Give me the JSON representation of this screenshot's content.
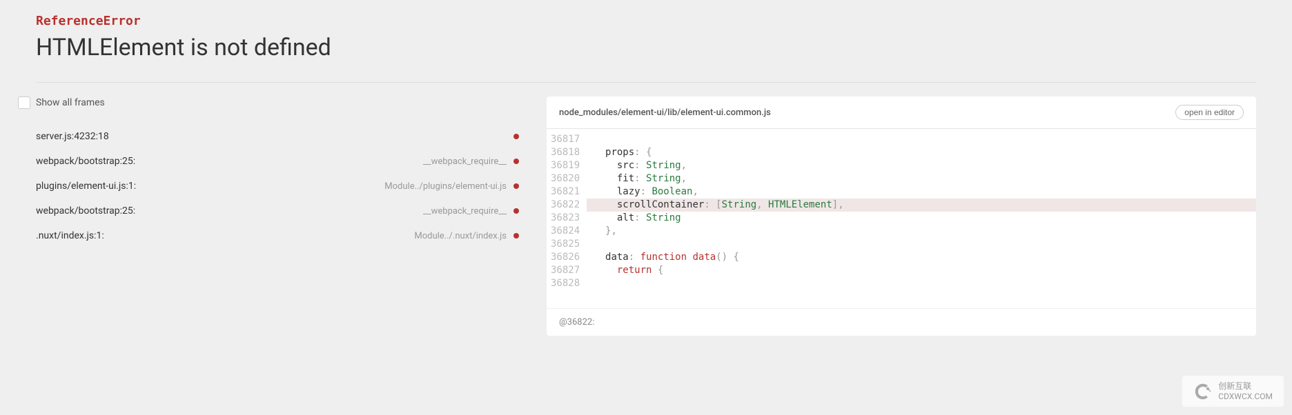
{
  "error": {
    "type": "ReferenceError",
    "message": "HTMLElement is not defined"
  },
  "showAllFrames": {
    "label": "Show all frames",
    "checked": false
  },
  "frames": [
    {
      "left": "server.js:4232:18",
      "right": ""
    },
    {
      "left": "webpack/bootstrap:25:",
      "right": "__webpack_require__"
    },
    {
      "left": "plugins/element-ui.js:1:",
      "right": "Module../plugins/element-ui.js"
    },
    {
      "left": "webpack/bootstrap:25:",
      "right": "__webpack_require__"
    },
    {
      "left": ".nuxt/index.js:1:",
      "right": "Module../.nuxt/index.js"
    }
  ],
  "source": {
    "filePath": "node_modules/element-ui/lib/element-ui.common.js",
    "openInEditorLabel": "open in editor",
    "highlightLine": 36822,
    "footer": "@36822:",
    "lines": [
      {
        "num": 36817,
        "indent": 0,
        "segs": []
      },
      {
        "num": 36818,
        "indent": 2,
        "segs": [
          [
            "key",
            "props"
          ],
          [
            "punct",
            ": {"
          ]
        ]
      },
      {
        "num": 36819,
        "indent": 4,
        "segs": [
          [
            "key",
            "src"
          ],
          [
            "punct",
            ": "
          ],
          [
            "type",
            "String"
          ],
          [
            "punct",
            ","
          ]
        ]
      },
      {
        "num": 36820,
        "indent": 4,
        "segs": [
          [
            "key",
            "fit"
          ],
          [
            "punct",
            ": "
          ],
          [
            "type",
            "String"
          ],
          [
            "punct",
            ","
          ]
        ]
      },
      {
        "num": 36821,
        "indent": 4,
        "segs": [
          [
            "key",
            "lazy"
          ],
          [
            "punct",
            ": "
          ],
          [
            "type",
            "Boolean"
          ],
          [
            "punct",
            ","
          ]
        ]
      },
      {
        "num": 36822,
        "indent": 4,
        "segs": [
          [
            "key",
            "scrollContainer"
          ],
          [
            "punct",
            ": ["
          ],
          [
            "type",
            "String"
          ],
          [
            "punct",
            ", "
          ],
          [
            "type",
            "HTMLElement"
          ],
          [
            "punct",
            "],"
          ]
        ]
      },
      {
        "num": 36823,
        "indent": 4,
        "segs": [
          [
            "key",
            "alt"
          ],
          [
            "punct",
            ": "
          ],
          [
            "type",
            "String"
          ]
        ]
      },
      {
        "num": 36824,
        "indent": 2,
        "segs": [
          [
            "punct",
            "},"
          ]
        ]
      },
      {
        "num": 36825,
        "indent": 0,
        "segs": []
      },
      {
        "num": 36826,
        "indent": 2,
        "segs": [
          [
            "key",
            "data"
          ],
          [
            "punct",
            ": "
          ],
          [
            "keyword",
            "function"
          ],
          [
            "punct",
            " "
          ],
          [
            "func",
            "data"
          ],
          [
            "punct",
            "() {"
          ]
        ]
      },
      {
        "num": 36827,
        "indent": 4,
        "segs": [
          [
            "keyword",
            "return"
          ],
          [
            "punct",
            " {"
          ]
        ]
      },
      {
        "num": 36828,
        "indent": 0,
        "segs": []
      }
    ]
  },
  "watermark": {
    "line1": "创新互联",
    "line2": "CDXWCX.COM"
  }
}
